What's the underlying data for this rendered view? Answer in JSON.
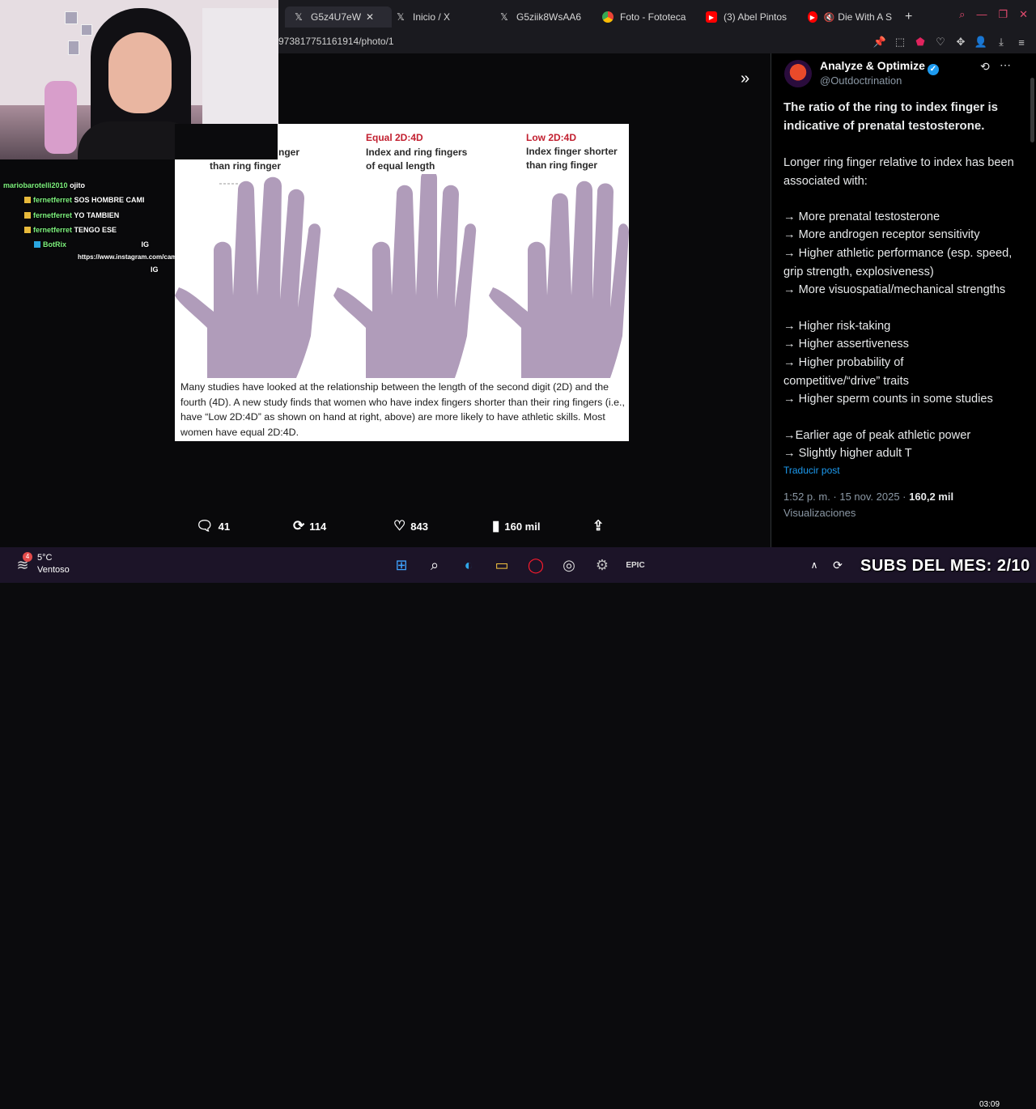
{
  "browser": {
    "tabs": [
      {
        "label": "G5z4U7eW",
        "icon": "x-logo-icon"
      },
      {
        "label": "Inicio / X",
        "icon": "x-logo-icon"
      },
      {
        "label": "G5ziik8WsAA6",
        "icon": "x-logo-icon"
      },
      {
        "label": "Foto - Fototeca",
        "icon": "chrome-logo-icon"
      },
      {
        "label": "(3) Abel Pintos",
        "icon": "youtube-icon"
      },
      {
        "label": "Die With A S",
        "icon": "youtube-icon"
      }
    ],
    "url": "973817751161914/photo/1"
  },
  "chat": [
    {
      "user": "mariobarotelli2010",
      "message": "ojito"
    },
    {
      "user": "fernetferret",
      "message": "SOS HOMBRE CAMI"
    },
    {
      "user": "fernetferret",
      "message": "YO TAMBIEN"
    },
    {
      "user": "fernetferret",
      "message": "TENGO ESE"
    },
    {
      "user": "BotRix",
      "message": "IG"
    },
    {
      "user": "",
      "message": "https://www.instagram.com/camimarcial"
    },
    {
      "user": "",
      "message": "IG"
    }
  ],
  "photo": {
    "left_label_line1": "nger",
    "left_label_line2": "than ring finger",
    "mid_title": "Equal 2D:4D",
    "mid_line1": "Index and ring fingers",
    "mid_line2": "of equal length",
    "right_title": "Low 2D:4D",
    "right_line1": "Index finger shorter",
    "right_line2": "than ring finger",
    "caption": "Many studies have looked at the relationship between the length of the second digit (2D) and the fourth (4D). A new study finds that women who have index fingers shorter than their ring fingers (i.e., have “Low 2D:4D” as shown on hand at right, above) are more likely to have athletic skills. Most women have equal 2D:4D.",
    "hand_color": "#b09cba"
  },
  "counts": {
    "replies": "41",
    "reposts": "114",
    "likes": "843",
    "views": "160 mil"
  },
  "post": {
    "author": "Analyze & Optimize",
    "handle": "@Outdoctrination",
    "headline": "The ratio of the ring to index finger is indicative of prenatal testosterone.",
    "intro": "Longer ring finger relative to index has been associated with:",
    "points": [
      "→ More prenatal testosterone",
      "→ More androgen receptor sensitivity",
      "→ Higher athletic performance (esp. speed, grip strength, explosiveness)",
      "→ More visuospatial/mechanical strengths",
      "→ Higher risk-taking",
      "→ Higher assertiveness",
      "→ Higher probability of competitive/“drive” traits",
      "→ Higher sperm counts in some studies",
      "→Earlier age of peak athletic power",
      "→ Slightly higher adult T"
    ],
    "translate": "Traducir post",
    "time": "1:52 p. m. · 15 nov. 2025 ·",
    "views_count": "160,2 mil",
    "views_label": "Visualizaciones"
  },
  "taskbar": {
    "temp": "5°C",
    "weather": "Ventoso",
    "clock": "03:09",
    "subs": "SUBS DEL MES: 2/10"
  },
  "colors": {
    "accent": "#1d9bf0",
    "tabbar": "#1a1a1f",
    "hand": "#b09cba"
  }
}
